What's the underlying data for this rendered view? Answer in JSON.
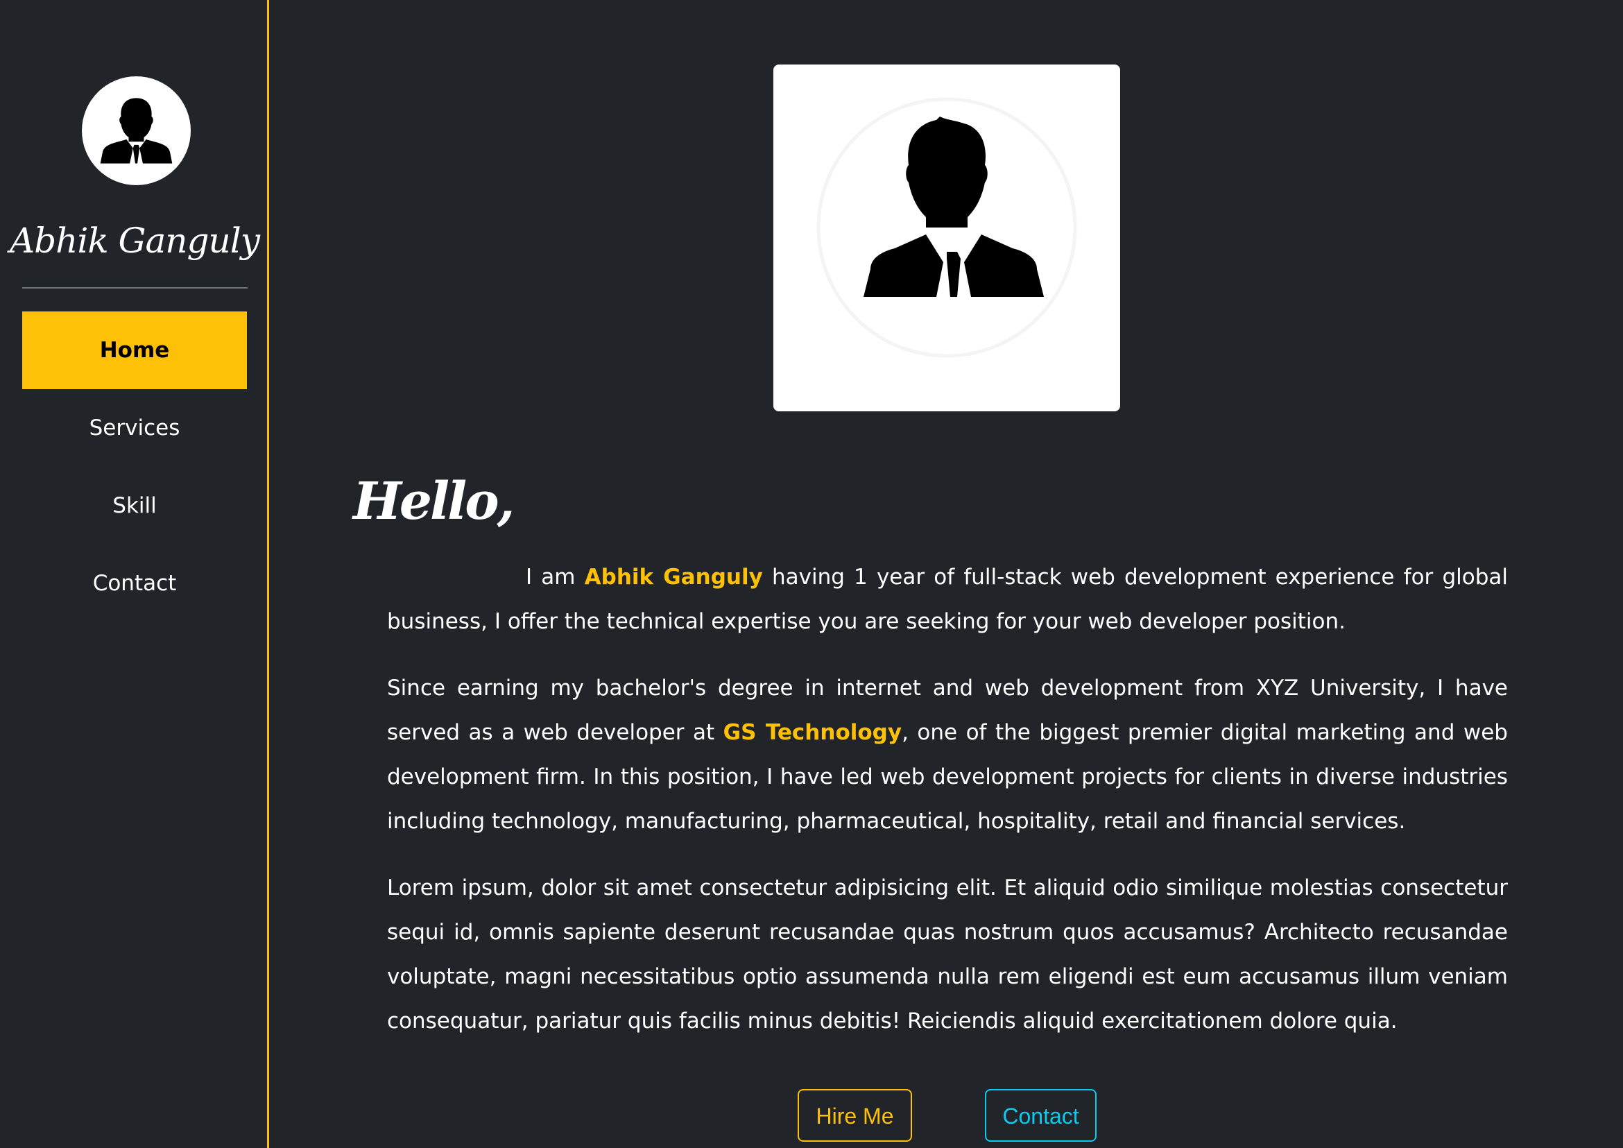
{
  "sidebar": {
    "avatar_icon": "user-silhouette-icon",
    "brand_name": "Abhik Ganguly",
    "nav": [
      {
        "label": "Home",
        "active": true
      },
      {
        "label": "Services",
        "active": false
      },
      {
        "label": "Skill",
        "active": false
      },
      {
        "label": "Contact",
        "active": false
      }
    ]
  },
  "main": {
    "profile_image_icon": "user-silhouette-icon",
    "greeting": "Hello,",
    "intro": {
      "p1_before": "I am ",
      "p1_name": "Abhik Ganguly",
      "p1_after": " having 1 year of full-stack web development experience for global business, I offer the technical expertise you are seeking for your web developer position.",
      "p2_before": "Since earning my bachelor's degree in internet and web development from XYZ University, I have served as a web developer at ",
      "p2_company": "GS Technology",
      "p2_after": ", one of the biggest premier digital marketing and web development firm. In this position, I have led web development projects for clients in diverse industries including technology, manufacturing, pharmaceutical, hospitality, retail and financial services.",
      "p3": "Lorem ipsum, dolor sit amet consectetur adipisicing elit. Et aliquid odio similique molestias consectetur sequi id, omnis sapiente deserunt recusandae quas nostrum quos accusamus? Architecto recusandae voluptate, magni necessitatibus optio assumenda nulla rem eligendi est eum accusamus illum veniam consequatur, pariatur quis facilis minus debitis! Reiciendis aliquid exercitationem dolore quia."
    },
    "buttons": {
      "hire_label": "Hire Me",
      "contact_label": "Contact"
    }
  },
  "colors": {
    "background": "#212529",
    "accent": "#ffc107",
    "info": "#0dcaf0",
    "text": "#ffffff"
  }
}
